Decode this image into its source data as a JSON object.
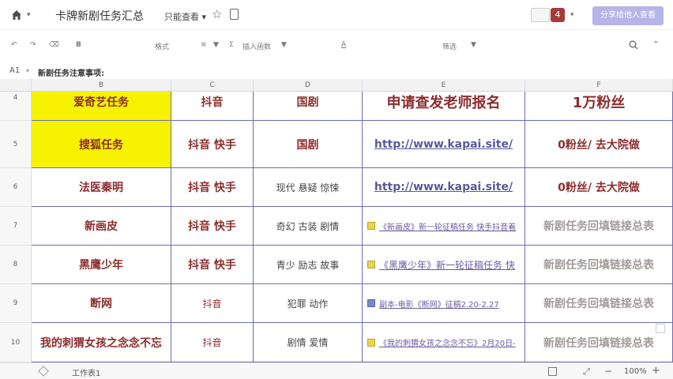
{
  "titlebar": {
    "title": "卡牌新剧任务汇总",
    "permission": "只能查看",
    "badge": "4",
    "share_label": "分享给他人查看"
  },
  "toolbar": {
    "items": [
      "↶",
      "↷",
      "⌫",
      "B",
      "格式",
      "≡",
      "▼",
      "Σ",
      "插入函数",
      "▼",
      "A",
      "筛选",
      "▼"
    ]
  },
  "formula_bar": {
    "cell_ref": "A1",
    "content": "新剧任务注意事项:"
  },
  "columns": [
    "B",
    "C",
    "D",
    "E",
    "F"
  ],
  "rows": [
    {
      "num": "4",
      "b": "爱奇艺任务",
      "c": "抖音",
      "d": "国剧",
      "e": "申请查发老师报名",
      "f": "1万粉丝"
    },
    {
      "num": "5",
      "b": "搜狐任务",
      "c": "抖音 快手",
      "d": "国剧",
      "e": "http://www.kapai.site/",
      "f": "0粉丝/ 去大院做"
    },
    {
      "num": "6",
      "b": "法医秦明",
      "c": "抖音 快手",
      "d": "现代 悬疑 惊悚",
      "e": "http://www.kapai.site/",
      "f": "0粉丝/ 去大院做"
    },
    {
      "num": "7",
      "b": "新画皮",
      "c": "抖音 快手",
      "d": "奇幻 古装 剧情",
      "e": "《新画皮》新一轮征稿任务 快手抖音着",
      "f": "新剧任务回填链接总表"
    },
    {
      "num": "8",
      "b": "黑鹰少年",
      "c": "抖音 快手",
      "d": "青少 励志 故事",
      "e": "《黑鹰少年》新一轮征稿任务 快",
      "f": "新剧任务回填链接总表"
    },
    {
      "num": "9",
      "b": "断网",
      "c": "抖音",
      "d": "犯罪 动作",
      "e": "副本-电影《断网》征稿2.20-2.27",
      "f": "新剧任务回填链接总表"
    },
    {
      "num": "10",
      "b": "我的刺猬女孩之念念不忘",
      "c": "抖音",
      "d": "剧情 爱情",
      "e": "《我的刺猬女孩之念念不忘》2月20日-",
      "f": "新剧任务回填链接总表"
    }
  ],
  "bottombar": {
    "sheet": "工作表1",
    "zoom": "100%",
    "zoom_out": "−",
    "zoom_in": "+"
  }
}
